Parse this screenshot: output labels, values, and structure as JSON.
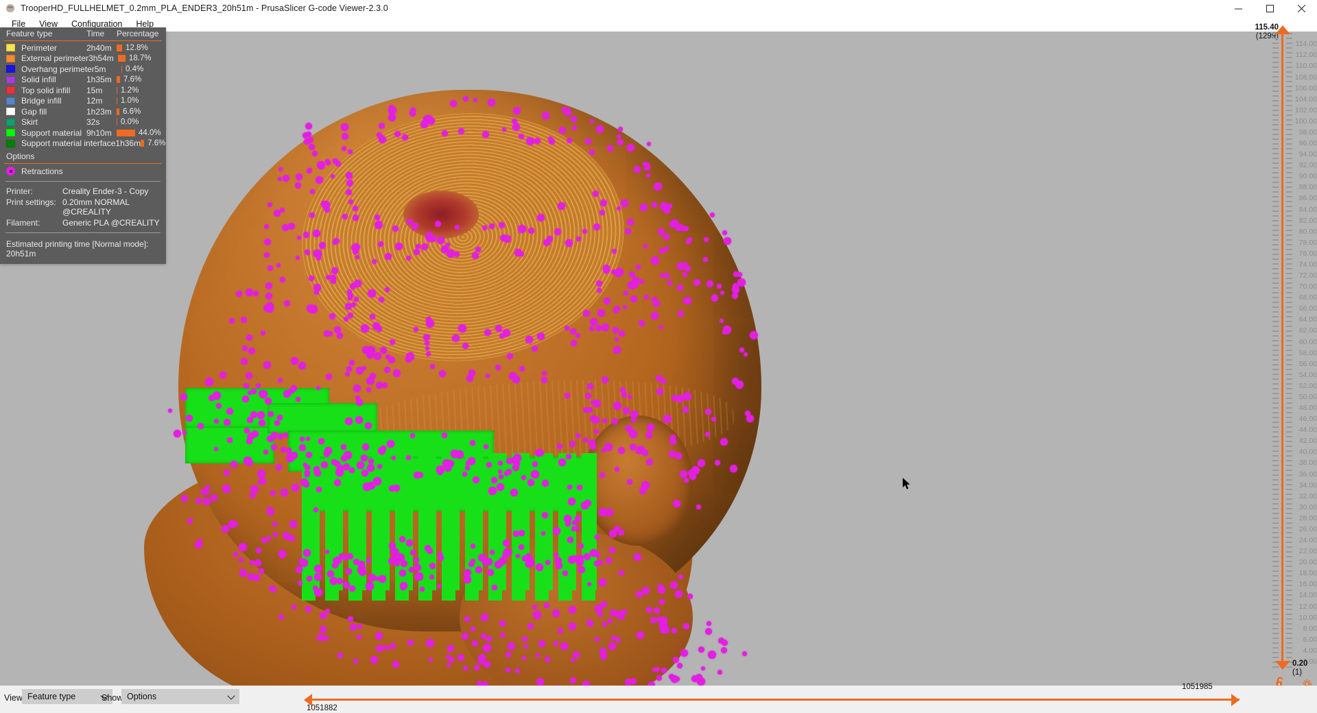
{
  "window": {
    "title": "TrooperHD_FULLHELMET_0.2mm_PLA_ENDER3_20h51m - PrusaSlicer G-code Viewer-2.3.0",
    "app_icon": "prusaslicer-icon",
    "minimize_label": "─",
    "maximize_label": "☐",
    "close_label": "✕"
  },
  "menubar": {
    "items": [
      {
        "label": "File"
      },
      {
        "label": "View"
      },
      {
        "label": "Configuration"
      },
      {
        "label": "Help"
      }
    ]
  },
  "legend": {
    "headers": {
      "name": "Feature type",
      "time": "Time",
      "percentage": "Percentage"
    },
    "rows": [
      {
        "label": "Perimeter",
        "color": "#f7e34e",
        "time": "2h40m",
        "percentage": "12.8%",
        "pct_value": 12.8
      },
      {
        "label": "External perimeter",
        "color": "#f08c36",
        "time": "3h54m",
        "percentage": "18.7%",
        "pct_value": 18.7
      },
      {
        "label": "Overhang perimeter",
        "color": "#1a12e8",
        "time": "5m",
        "percentage": "0.4%",
        "pct_value": 0.4
      },
      {
        "label": "Solid infill",
        "color": "#a33fd8",
        "time": "1h35m",
        "percentage": "7.6%",
        "pct_value": 7.6
      },
      {
        "label": "Top solid infill",
        "color": "#e8313f",
        "time": "15m",
        "percentage": "1.2%",
        "pct_value": 1.2
      },
      {
        "label": "Bridge infill",
        "color": "#5287c6",
        "time": "12m",
        "percentage": "1.0%",
        "pct_value": 1.0
      },
      {
        "label": "Gap fill",
        "color": "#ffffff",
        "time": "1h23m",
        "percentage": "6.6%",
        "pct_value": 6.6
      },
      {
        "label": "Skirt",
        "color": "#0ea16f",
        "time": "32s",
        "percentage": "0.0%",
        "pct_value": 0.0
      },
      {
        "label": "Support material",
        "color": "#00ff00",
        "time": "9h10m",
        "percentage": "44.0%",
        "pct_value": 44.0
      },
      {
        "label": "Support material interface",
        "color": "#008000",
        "time": "1h36m",
        "percentage": "7.6%",
        "pct_value": 7.6
      }
    ],
    "options_title": "Options",
    "options": [
      {
        "label": "Retractions",
        "color": "#e21fe2",
        "icon": "retraction-dot-icon"
      }
    ],
    "info": [
      {
        "key": "Printer:",
        "value": "Creality Ender-3 - Copy"
      },
      {
        "key": "Print settings:",
        "value": "0.20mm NORMAL @CREALITY"
      },
      {
        "key": "Filament:",
        "value": "Generic PLA @CREALITY"
      }
    ],
    "estimate_label": "Estimated printing time [Normal mode]:",
    "estimate_value": "20h51m",
    "accent_color": "#ed6b21",
    "panel_bg": "#5c5c5c"
  },
  "vertical_slider": {
    "top_value": "115.40",
    "top_index": "(1299)",
    "bottom_value": "0.20",
    "bottom_index": "(1)",
    "lock_icon": "unlocked-padlock-icon",
    "settings_icon": "gear-icon",
    "ticks": [
      "114.00",
      "112.00",
      "110.00",
      "108.00",
      "106.00",
      "104.00",
      "102.00",
      "100.00",
      "98.00",
      "96.00",
      "94.00",
      "92.00",
      "90.00",
      "88.00",
      "86.00",
      "84.00",
      "82.00",
      "80.00",
      "78.00",
      "76.00",
      "74.00",
      "72.00",
      "70.00",
      "68.00",
      "66.00",
      "64.00",
      "62.00",
      "60.00",
      "58.00",
      "56.00",
      "54.00",
      "52.00",
      "50.00",
      "48.00",
      "46.00",
      "44.00",
      "42.00",
      "40.00",
      "38.00",
      "36.00",
      "34.00",
      "32.00",
      "30.00",
      "28.00",
      "26.00",
      "24.00",
      "22.00",
      "20.00",
      "18.00",
      "16.00",
      "14.00",
      "12.00",
      "10.00",
      "8.00",
      "6.00",
      "4.00",
      "2.00"
    ]
  },
  "bottom_bar": {
    "view_label": "View",
    "view_value": "Feature type",
    "show_label": "Show",
    "show_value": "Options",
    "move_min": "1051882",
    "move_max": "1051985"
  },
  "viewport": {
    "cursor_icon": "mouse-pointer-icon",
    "model_name": "trooper-helmet-gcode-preview"
  }
}
